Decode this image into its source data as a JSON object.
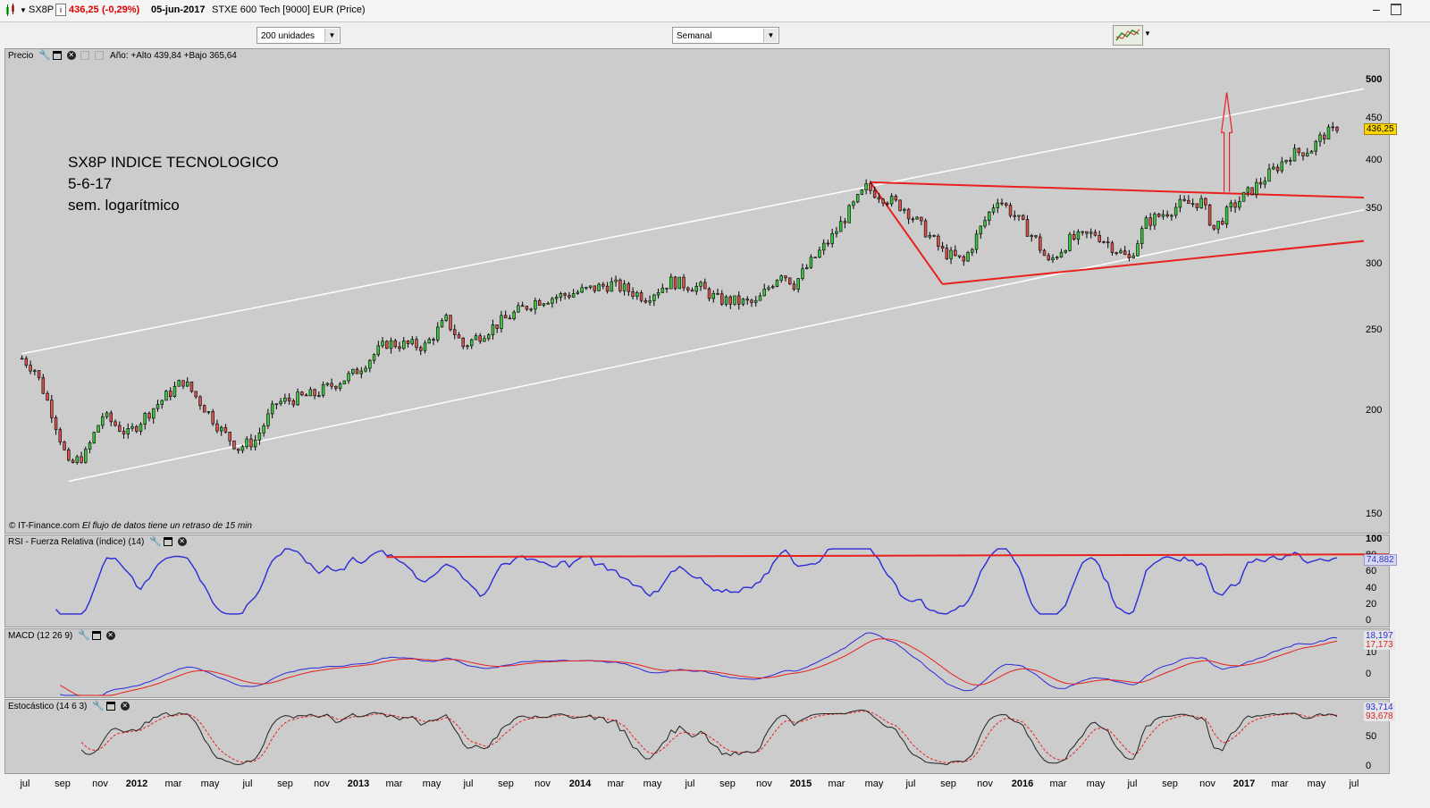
{
  "header": {
    "symbol": "SX8P",
    "price": "436,25",
    "change": "(-0,29%)",
    "date": "05-jun-2017",
    "instrument": "STXE 600 Tech [9000] EUR (Price)",
    "info_icon": "i"
  },
  "toolbar": {
    "units_select": "200 unidades",
    "period_select": "Semanal"
  },
  "price_panel": {
    "title": "Precio",
    "year_stats": "Año: +Alto 439,84 +Bajo 365,64",
    "last_price_tag": "436,25",
    "credit_site": "© IT-Finance.com",
    "credit_note": "El flujo de datos tiene un retraso de 15 min",
    "annotation_lines": [
      "SX8P INDICE TECNOLOGICO",
      "5-6-17",
      "sem. logarítmico"
    ],
    "y_ticks": [
      "500",
      "450",
      "400",
      "350",
      "300",
      "250",
      "200",
      "150"
    ]
  },
  "rsi_panel": {
    "title": "RSI - Fuerza Relativa (índice) (14)",
    "value_tag": "74,882",
    "y_ticks": [
      "100",
      "80",
      "60",
      "40",
      "20",
      "0"
    ]
  },
  "macd_panel": {
    "title": "MACD (12 26 9)",
    "value_tag_1": "18,197",
    "value_tag_2": "17,173",
    "y_ticks": [
      "10",
      "0"
    ]
  },
  "stoch_panel": {
    "title": "Estocástico (14 6 3)",
    "value_tag_1": "93,714",
    "value_tag_2": "93,678",
    "y_ticks": [
      "50",
      "0"
    ]
  },
  "x_axis": {
    "labels": [
      {
        "t": "jul",
        "year": false
      },
      {
        "t": "sep",
        "year": false
      },
      {
        "t": "nov",
        "year": false
      },
      {
        "t": "2012",
        "year": true
      },
      {
        "t": "mar",
        "year": false
      },
      {
        "t": "may",
        "year": false
      },
      {
        "t": "jul",
        "year": false
      },
      {
        "t": "sep",
        "year": false
      },
      {
        "t": "nov",
        "year": false
      },
      {
        "t": "2013",
        "year": true
      },
      {
        "t": "mar",
        "year": false
      },
      {
        "t": "may",
        "year": false
      },
      {
        "t": "jul",
        "year": false
      },
      {
        "t": "sep",
        "year": false
      },
      {
        "t": "nov",
        "year": false
      },
      {
        "t": "2014",
        "year": true
      },
      {
        "t": "mar",
        "year": false
      },
      {
        "t": "may",
        "year": false
      },
      {
        "t": "jul",
        "year": false
      },
      {
        "t": "sep",
        "year": false
      },
      {
        "t": "nov",
        "year": false
      },
      {
        "t": "2015",
        "year": true
      },
      {
        "t": "mar",
        "year": false
      },
      {
        "t": "may",
        "year": false
      },
      {
        "t": "jul",
        "year": false
      },
      {
        "t": "sep",
        "year": false
      },
      {
        "t": "nov",
        "year": false
      },
      {
        "t": "2016",
        "year": true
      },
      {
        "t": "mar",
        "year": false
      },
      {
        "t": "may",
        "year": false
      },
      {
        "t": "jul",
        "year": false
      },
      {
        "t": "sep",
        "year": false
      },
      {
        "t": "nov",
        "year": false
      },
      {
        "t": "2017",
        "year": true
      },
      {
        "t": "mar",
        "year": false
      },
      {
        "t": "may",
        "year": false
      },
      {
        "t": "jul",
        "year": false
      }
    ]
  },
  "colors": {
    "up_candle": "#3ec83e",
    "down_candle": "#d9534f",
    "trendline": "#e8201e",
    "channel": "#ffffff",
    "rsi": "#2b2bd9",
    "macd": "#2b2bd9",
    "signal": "#e8201e",
    "panel_bg": "#cccccc",
    "price_tag_bg": "#ffd700"
  },
  "chart_data": {
    "type": "candlestick",
    "title": "SX8P INDICE TECNOLOGICO",
    "scale": "log",
    "frequency": "weekly",
    "ylim": [
      140,
      520
    ],
    "x_range": [
      "2011-07",
      "2017-07"
    ],
    "price_path": [
      [
        "2011-06-24",
        232
      ],
      [
        "2011-07-15",
        225
      ],
      [
        "2011-08-12",
        200
      ],
      [
        "2011-09-09",
        172
      ],
      [
        "2011-10-07",
        178
      ],
      [
        "2011-11-04",
        198
      ],
      [
        "2011-12-16",
        188
      ],
      [
        "2012-01-20",
        200
      ],
      [
        "2012-03-16",
        218
      ],
      [
        "2012-05-18",
        190
      ],
      [
        "2012-06-15",
        181
      ],
      [
        "2012-07-13",
        185
      ],
      [
        "2012-08-17",
        205
      ],
      [
        "2012-10-19",
        210
      ],
      [
        "2012-12-21",
        222
      ],
      [
        "2013-02-15",
        242
      ],
      [
        "2013-04-19",
        240
      ],
      [
        "2013-05-24",
        258
      ],
      [
        "2013-06-21",
        240
      ],
      [
        "2013-08-16",
        255
      ],
      [
        "2013-10-18",
        272
      ],
      [
        "2013-12-20",
        278
      ],
      [
        "2014-02-21",
        285
      ],
      [
        "2014-04-18",
        275
      ],
      [
        "2014-05-30",
        287
      ],
      [
        "2014-07-18",
        282
      ],
      [
        "2014-08-15",
        273
      ],
      [
        "2014-10-17",
        270
      ],
      [
        "2014-11-28",
        295
      ],
      [
        "2014-12-19",
        285
      ],
      [
        "2015-02-20",
        325
      ],
      [
        "2015-04-17",
        372
      ],
      [
        "2015-06-19",
        352
      ],
      [
        "2015-08-21",
        312
      ],
      [
        "2015-09-25",
        303
      ],
      [
        "2015-11-20",
        362
      ],
      [
        "2016-01-22",
        322
      ],
      [
        "2016-02-12",
        302
      ],
      [
        "2016-03-18",
        322
      ],
      [
        "2016-04-29",
        328
      ],
      [
        "2016-06-24",
        305
      ],
      [
        "2016-07-22",
        338
      ],
      [
        "2016-09-16",
        355
      ],
      [
        "2016-10-21",
        358
      ],
      [
        "2016-11-11",
        332
      ],
      [
        "2016-12-09",
        352
      ],
      [
        "2017-01-27",
        378
      ],
      [
        "2017-03-17",
        408
      ],
      [
        "2017-04-21",
        415
      ],
      [
        "2017-05-12",
        432
      ],
      [
        "2017-06-02",
        436.25
      ]
    ],
    "trendlines": [
      {
        "name": "upper channel",
        "from": [
          "2011-06-24",
          235
        ],
        "to": [
          "2017-07-30",
          492
        ]
      },
      {
        "name": "lower channel",
        "from": [
          "2011-09-09",
          165
        ],
        "to": [
          "2017-07-30",
          352
        ]
      },
      {
        "name": "triangle top",
        "from": [
          "2015-04-24",
          378
        ],
        "to": [
          "2017-07-30",
          362
        ]
      },
      {
        "name": "triangle bottom",
        "from": [
          "2015-08-21",
          285
        ],
        "to": [
          "2017-07-30",
          322
        ]
      },
      {
        "name": "triangle left edge",
        "from": [
          "2015-04-24",
          378
        ],
        "to": [
          "2015-08-21",
          285
        ]
      }
    ],
    "target_arrow": {
      "from": [
        "2016-12-02",
        368
      ],
      "to": [
        "2016-12-02",
        485
      ]
    },
    "rsi": {
      "last": 74.882,
      "resistance": 80,
      "ylim": [
        0,
        100
      ]
    },
    "macd": {
      "last_macd": 18.197,
      "last_signal": 17.173
    },
    "stochastic": {
      "last_k": 93.714,
      "last_d": 93.678,
      "ylim": [
        0,
        100
      ]
    }
  }
}
